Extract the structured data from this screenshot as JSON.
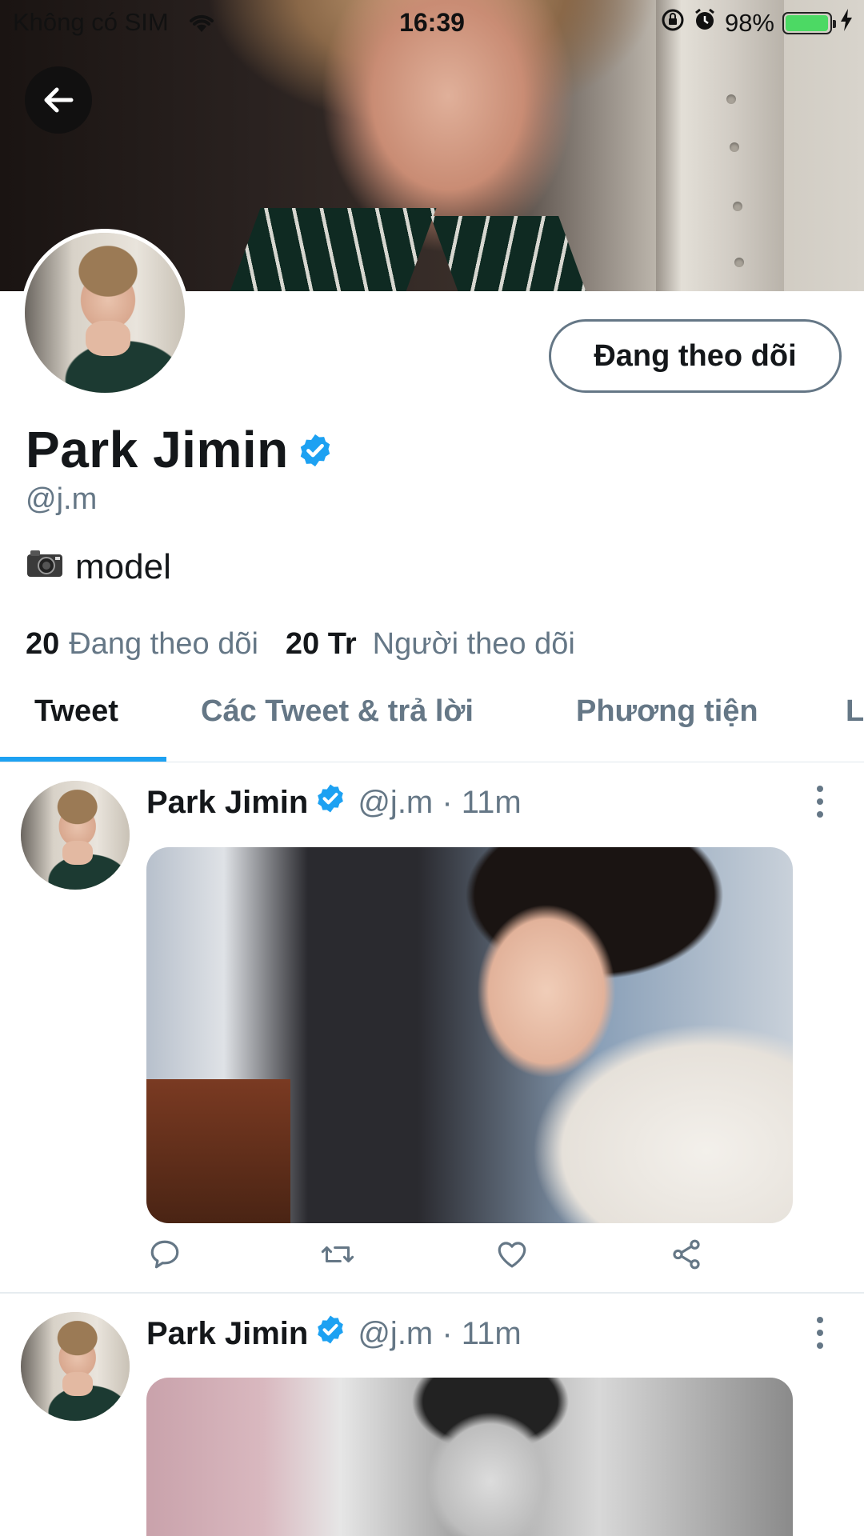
{
  "status_bar": {
    "carrier": "Không có SIM",
    "time": "16:39",
    "battery": "98%",
    "battery_level": 0.98
  },
  "profile": {
    "name": "Park Jimin",
    "handle": "@j.m",
    "bio_emoji": "📷",
    "bio_text": "model",
    "follow_button_label": "Đang theo dõi",
    "following_count": "20",
    "following_label": "Đang theo dõi",
    "followers_count": "20 Tr",
    "followers_label": "Người theo dõi",
    "verified": true
  },
  "tabs": [
    {
      "label": "Tweet",
      "active": true
    },
    {
      "label": "Các Tweet & trả lời",
      "active": false
    },
    {
      "label": "Phương tiện",
      "active": false
    },
    {
      "label": "L",
      "active": false
    }
  ],
  "tweets": [
    {
      "name": "Park Jimin",
      "handle_time": "@j.m · 11m",
      "has_media": true
    },
    {
      "name": "Park Jimin",
      "handle_time": "@j.m · 11m",
      "has_media": true
    }
  ],
  "colors": {
    "accent": "#1da1f2",
    "text_primary": "#14171a",
    "text_secondary": "#657786",
    "battery_green": "#4cd964"
  },
  "icons": {
    "back": "arrow-left-icon",
    "reply": "reply-icon",
    "retweet": "retweet-icon",
    "like": "heart-icon",
    "share": "share-icon",
    "more": "more-vertical-icon",
    "verified": "verified-badge-icon"
  }
}
